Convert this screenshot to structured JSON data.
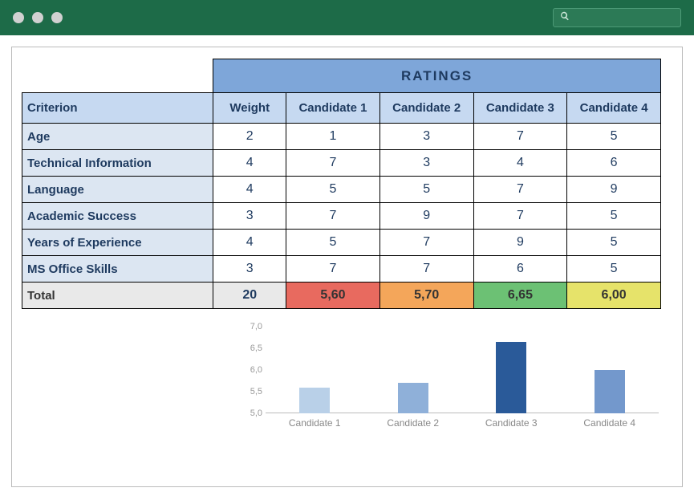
{
  "header": {
    "ratings_label": "RATINGS",
    "criterion_label": "Criterion",
    "weight_label": "Weight",
    "candidates": [
      "Candidate 1",
      "Candidate 2",
      "Candidate 3",
      "Candidate 4"
    ]
  },
  "rows": [
    {
      "criterion": "Age",
      "weight": "2",
      "vals": [
        "1",
        "3",
        "7",
        "5"
      ]
    },
    {
      "criterion": "Technical Information",
      "weight": "4",
      "vals": [
        "7",
        "3",
        "4",
        "6"
      ]
    },
    {
      "criterion": "Language",
      "weight": "4",
      "vals": [
        "5",
        "5",
        "7",
        "9"
      ]
    },
    {
      "criterion": "Academic Success",
      "weight": "3",
      "vals": [
        "7",
        "9",
        "7",
        "5"
      ]
    },
    {
      "criterion": "Years of Experience",
      "weight": "4",
      "vals": [
        "5",
        "7",
        "9",
        "5"
      ]
    },
    {
      "criterion": "MS Office Skills",
      "weight": "3",
      "vals": [
        "7",
        "7",
        "6",
        "5"
      ]
    }
  ],
  "total": {
    "label": "Total",
    "weight": "20",
    "scores": [
      {
        "text": "5,60",
        "value": 5.6,
        "class": "sc-red"
      },
      {
        "text": "5,70",
        "value": 5.7,
        "class": "sc-orange"
      },
      {
        "text": "6,65",
        "value": 6.65,
        "class": "sc-green"
      },
      {
        "text": "6,00",
        "value": 6.0,
        "class": "sc-yellow"
      }
    ]
  },
  "chart_data": {
    "type": "bar",
    "categories": [
      "Candidate 1",
      "Candidate 2",
      "Candidate 3",
      "Candidate 4"
    ],
    "values": [
      5.6,
      5.7,
      6.65,
      6.0
    ],
    "title": "",
    "xlabel": "",
    "ylabel": "",
    "ylim": [
      5.0,
      7.0
    ],
    "yticks": [
      "7,0",
      "6,5",
      "6,0",
      "5,5",
      "5,0"
    ],
    "bar_colors": [
      "#b9d0e8",
      "#8fb0d9",
      "#2a5a99",
      "#7398cc"
    ]
  }
}
